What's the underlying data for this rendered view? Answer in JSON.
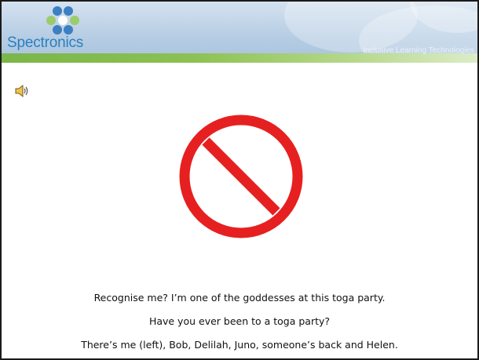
{
  "header": {
    "logo_text": "Spectronics",
    "tagline": "Inclusive Learning Technologies",
    "logo_icon": "flower-logo-icon"
  },
  "slide": {
    "audio_icon": "speaker-icon",
    "image_icon": "prohibited-sign-icon",
    "caption_lines": [
      "Recognise me?  I’m one of the goddesses at this toga party.",
      "Have you ever been to a toga party?",
      "There’s me (left), Bob, Delilah, Juno, someone’s back and Helen."
    ]
  },
  "colors": {
    "brand_blue": "#2a7fbf",
    "header_band_green": "#7ab648",
    "prohibited_red": "#e62020"
  }
}
